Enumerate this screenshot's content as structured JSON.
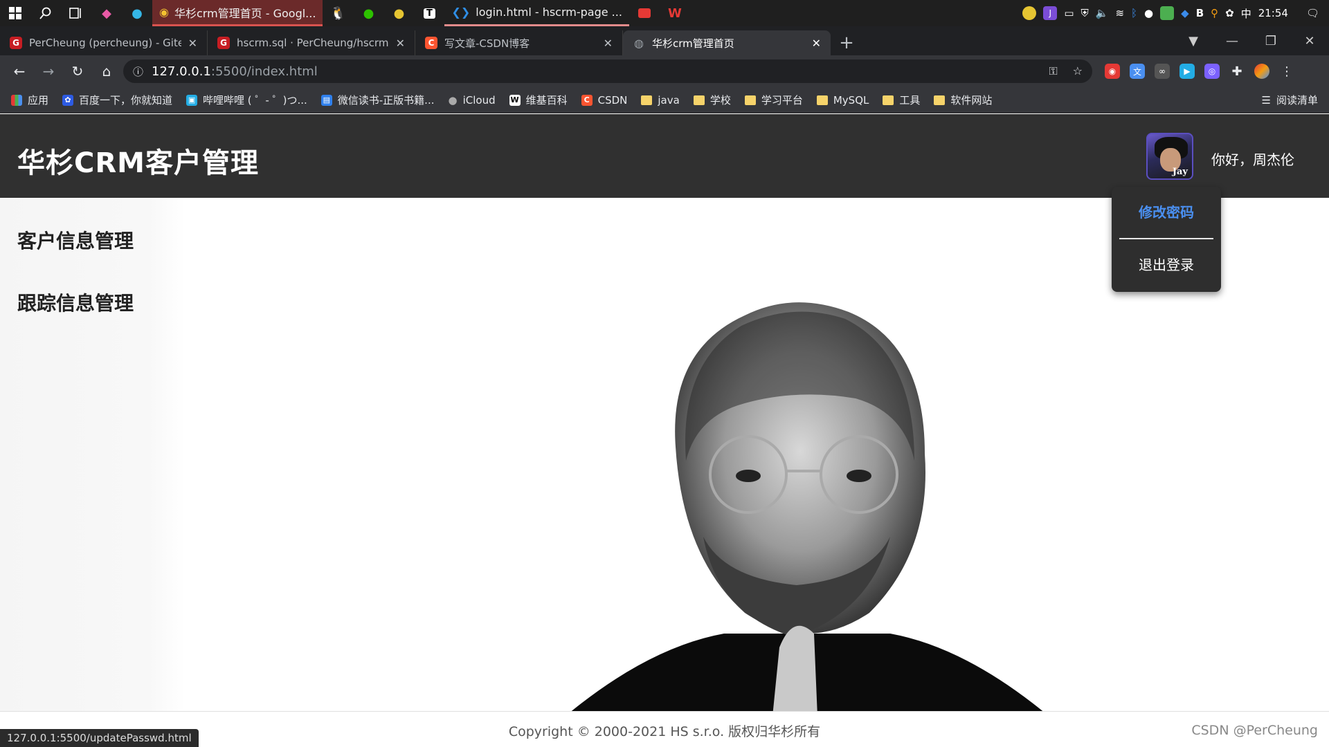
{
  "taskbar": {
    "apps": [
      {
        "label": "华杉crm管理首页 - Googl...",
        "active": true
      },
      {
        "label": "login.html - hscrm-page ...",
        "active": false
      }
    ],
    "tray": {
      "ime": "中",
      "time": "21:54"
    }
  },
  "browser": {
    "tabs": [
      {
        "title": "PerCheung (percheung) - Gitee",
        "favicon": "G",
        "color": "#c71d23"
      },
      {
        "title": "hscrm.sql · PerCheung/hscrm",
        "favicon": "G",
        "color": "#c71d23"
      },
      {
        "title": "写文章-CSDN博客",
        "favicon": "C",
        "color": "#fc5531"
      },
      {
        "title": "华杉crm管理首页",
        "favicon": "globe-icon",
        "color": "#9aa0a6",
        "active": true
      }
    ],
    "url_host": "127.0.0.1",
    "url_path": ":5500/index.html",
    "bookmarks": [
      {
        "label": "应用",
        "type": "apps-grid-icon"
      },
      {
        "label": "百度一下，你就知道",
        "type": "paw-icon"
      },
      {
        "label": "哔哩哔哩 ( ゜- ゜)つ...",
        "type": "tv-icon"
      },
      {
        "label": "微信读书-正版书籍...",
        "type": "book-icon"
      },
      {
        "label": "iCloud",
        "type": "apple-icon"
      },
      {
        "label": "维基百科",
        "type": "wiki-icon"
      },
      {
        "label": "CSDN",
        "type": "csdn-icon"
      },
      {
        "label": "java",
        "type": "folder"
      },
      {
        "label": "学校",
        "type": "folder"
      },
      {
        "label": "学习平台",
        "type": "folder"
      },
      {
        "label": "MySQL",
        "type": "folder"
      },
      {
        "label": "工具",
        "type": "folder"
      },
      {
        "label": "软件网站",
        "type": "folder"
      }
    ],
    "reading_list": "阅读清单",
    "status_url": "127.0.0.1:5500/updatePasswd.html"
  },
  "page": {
    "brand": "华杉CRM客户管理",
    "greeting": "你好，周杰伦",
    "avatar_signature": "Jay",
    "sidebar": [
      {
        "label": "客户信息管理"
      },
      {
        "label": "跟踪信息管理"
      }
    ],
    "dropdown": [
      {
        "label": "修改密码"
      },
      {
        "label": "退出登录"
      }
    ],
    "footer": "Copyright © 2000-2021 HS s.r.o. 版权归华杉所有",
    "watermark": "CSDN @PerCheung"
  },
  "colors": {
    "header_bg": "#303030",
    "accent": "#4a8ff0",
    "dropdown_bg": "#2e2e2e"
  }
}
